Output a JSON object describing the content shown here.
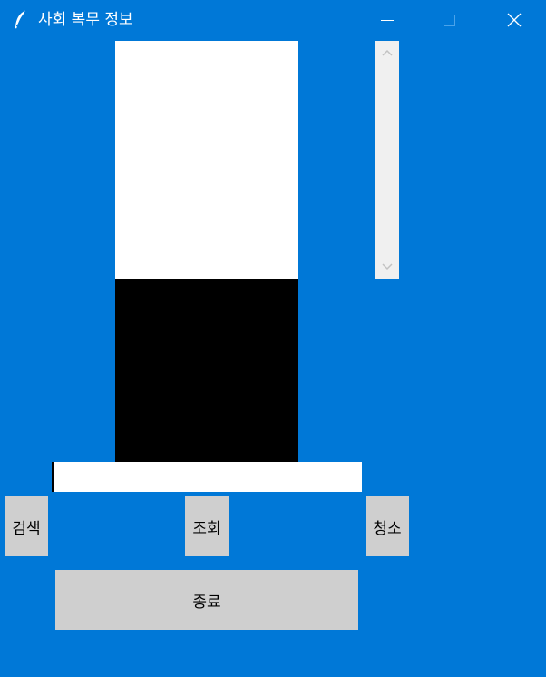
{
  "window": {
    "title": "사회 복무 정보",
    "icon": "feather-icon",
    "controls": [
      "minimize-icon",
      "maximize-icon",
      "close-icon"
    ]
  },
  "panels": {
    "upper_color": "#ffffff",
    "lower_color": "#000000"
  },
  "search": {
    "value": "",
    "placeholder": ""
  },
  "buttons": {
    "search_label": "검색",
    "query_label": "조회",
    "clean_label": "청소",
    "exit_label": "종료"
  },
  "colors": {
    "background": "#0078d7",
    "button": "#cfcfcf",
    "scrollbar": "#f0f0f0"
  }
}
